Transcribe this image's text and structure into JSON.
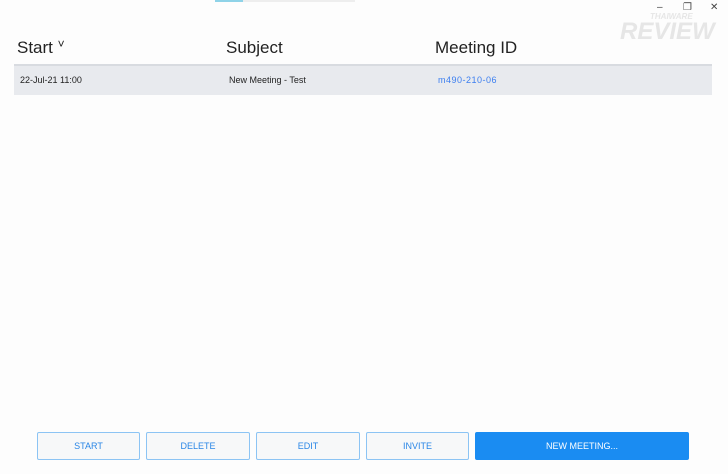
{
  "watermark": {
    "line1": "THAIWARE",
    "line2": "REVIEW"
  },
  "window": {
    "minimize": "–",
    "restore": "❐",
    "close": "✕"
  },
  "table": {
    "columns": {
      "start": "Start",
      "sort_icon": "˅",
      "subject": "Subject",
      "meeting_id": "Meeting ID"
    },
    "rows": [
      {
        "start": "22-Jul-21 11:00",
        "subject": "New Meeting - Test",
        "meeting_id": "m490-210-06"
      }
    ]
  },
  "buttons": {
    "start": "START",
    "delete": "DELETE",
    "edit": "EDIT",
    "invite": "INVITE",
    "new_meeting": "NEW MEETING..."
  }
}
